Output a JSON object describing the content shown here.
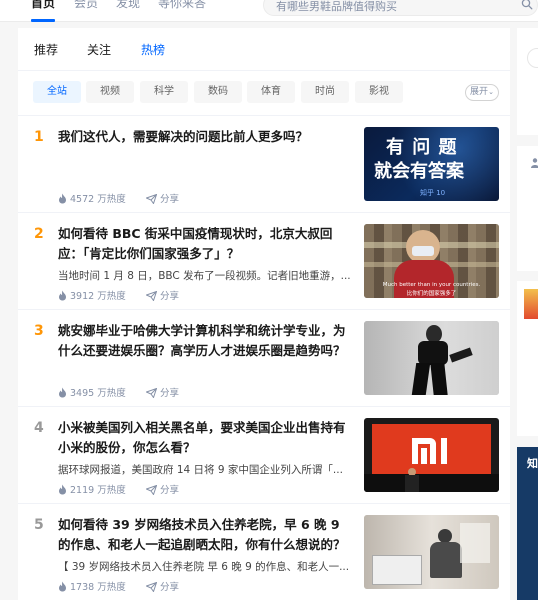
{
  "nav": {
    "items": [
      {
        "label": "首页",
        "active": true
      },
      {
        "label": "会员",
        "active": false
      },
      {
        "label": "发现",
        "active": false
      },
      {
        "label": "等你来答",
        "active": false
      }
    ],
    "search_placeholder": "有哪些男鞋品牌值得购买"
  },
  "tabs": [
    {
      "label": "推荐",
      "active": false
    },
    {
      "label": "关注",
      "active": false
    },
    {
      "label": "热榜",
      "active": true
    }
  ],
  "categories": [
    {
      "label": "全站",
      "active": true
    },
    {
      "label": "视频",
      "active": false
    },
    {
      "label": "科学",
      "active": false
    },
    {
      "label": "数码",
      "active": false
    },
    {
      "label": "体育",
      "active": false
    },
    {
      "label": "时尚",
      "active": false
    },
    {
      "label": "影视",
      "active": false
    }
  ],
  "expand_label": "展开",
  "hot_list": [
    {
      "rank": "1",
      "title": "我们这代人，需要解决的问题比前人更多吗？",
      "excerpt": "",
      "heat": "4572 万热度",
      "share": "分享",
      "thumb": {
        "line1": "有 问 题",
        "line2": "就会有答案",
        "caption": "知乎 10"
      }
    },
    {
      "rank": "2",
      "title": "如何看待 BBC 街采中国疫情现状时，北京大叔回应：「肯定比你们国家强多了」？",
      "excerpt": "当地时间 1 月 8 日，BBC 发布了一段视频。记者旧地重游，...",
      "heat": "3912 万热度",
      "share": "分享",
      "thumb": {
        "caption": "Much better than in your countries.",
        "caption2": "比你们的国家强多了"
      }
    },
    {
      "rank": "3",
      "title": "姚安娜毕业于哈佛大学计算机科学和统计学专业，为什么还要进娱乐圈？高学历人才进娱乐圈是趋势吗？",
      "excerpt": "",
      "heat": "3495 万热度",
      "share": "分享",
      "thumb": {}
    },
    {
      "rank": "4",
      "title": "小米被美国列入相关黑名单，要求美国企业出售持有小米的股份，你怎么看？",
      "excerpt": "据环球网报道，美国政府 14 日将 9 家中国企业列入所谓「...",
      "heat": "2119 万热度",
      "share": "分享",
      "thumb": {
        "logo": "mi"
      }
    },
    {
      "rank": "5",
      "title": "如何看待 39 岁网络技术员入住养老院，早 6 晚 9 的作息、和老人一起追剧晒太阳，你有什么想说的？",
      "excerpt": "【 39 岁网络技术员入住养老院 早 6 晚 9 的作息、和老人一...",
      "heat": "1738 万热度",
      "share": "分享",
      "thumb": {}
    }
  ],
  "right_column": {
    "fragment_text": "知"
  },
  "colors": {
    "accent": "#0066ff",
    "rank_hot": "#ff9607",
    "rank_normal": "#999999"
  }
}
